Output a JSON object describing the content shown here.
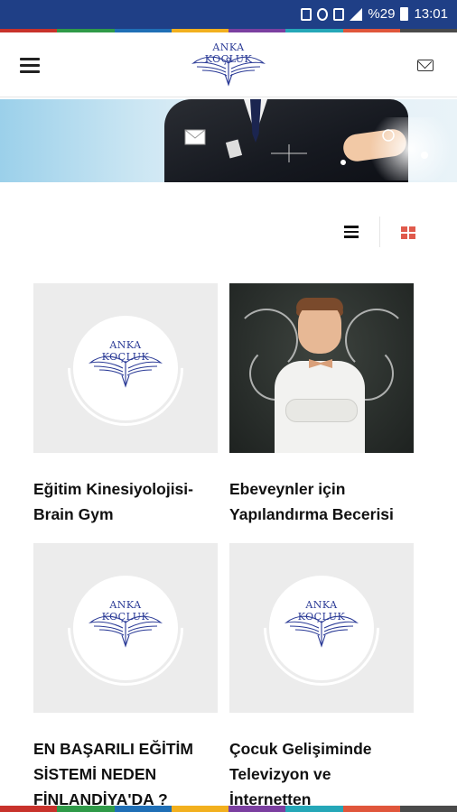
{
  "status_bar": {
    "battery": "%29",
    "time": "13:01",
    "icons": [
      "alarm-icon",
      "mute-icon",
      "wifi-call-icon",
      "signal-icon",
      "battery-icon"
    ]
  },
  "header": {
    "logo_text": "ANKA KOÇLUK",
    "menu_icon": "hamburger-menu-icon",
    "mail_icon": "mail-icon"
  },
  "view_toggle": {
    "list_icon": "list-view-icon",
    "grid_icon": "grid-view-icon",
    "active": "grid",
    "accent": "#e05a4c"
  },
  "articles": [
    {
      "title": "Eğitim Kinesiyolojisi-\nBrain Gym",
      "image": "placeholder-logo"
    },
    {
      "title": "Ebeveynler için\nYapılandırma Becerisi",
      "image": "photo"
    },
    {
      "title": "EN BAŞARILI EĞİTİM\nSİSTEMİ NEDEN\nFİNLANDİYA'DA ?",
      "image": "placeholder-logo"
    },
    {
      "title": "Çocuk Gelişiminde\nTelevizyon ve İnternetten\nNasıl Yararlanabiliriz?",
      "image": "placeholder-logo"
    }
  ],
  "placeholder_logo_text": "ANKA KOÇLUK",
  "colors": {
    "status_bar": "#1f3f86",
    "brand": "#2a3a96",
    "stripe": [
      "#c8322b",
      "#2f9a48",
      "#1f6fb6",
      "#f2b01e",
      "#7b3fa0",
      "#25a7b8",
      "#e0563b",
      "#4a4a4a"
    ]
  }
}
